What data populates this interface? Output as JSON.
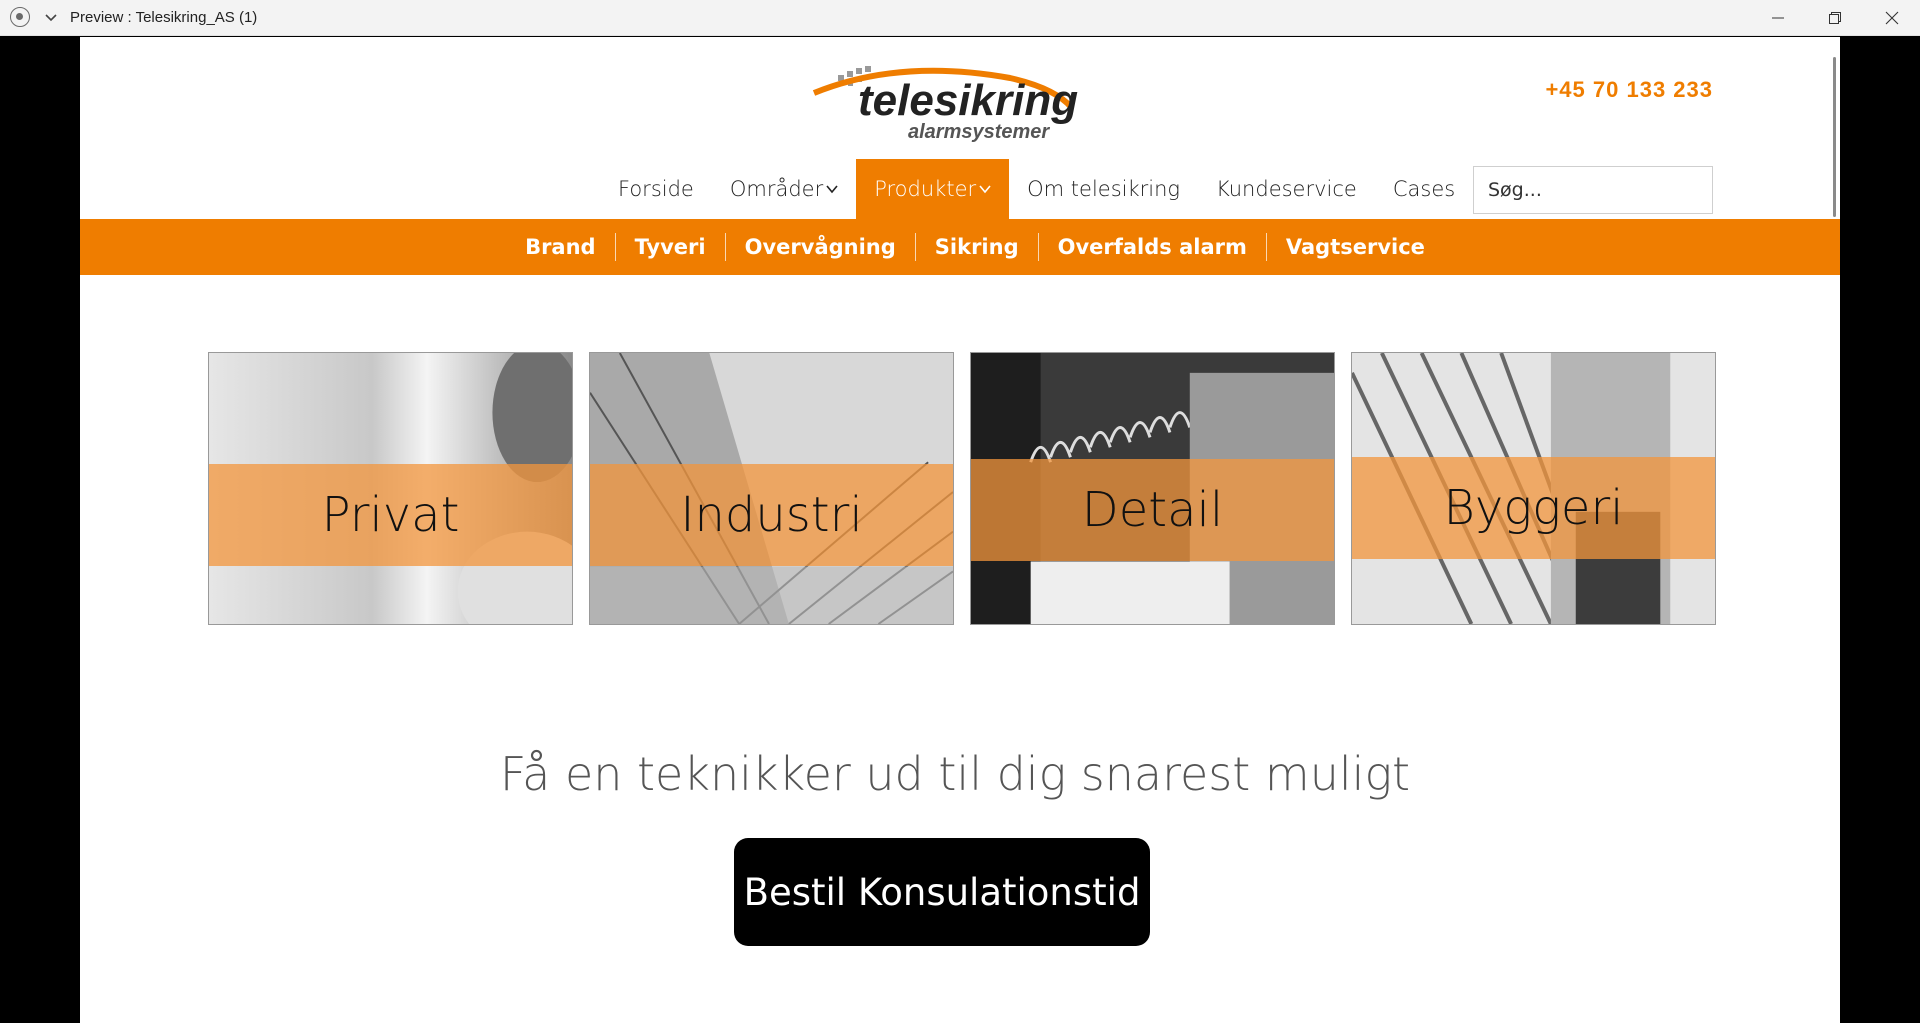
{
  "window": {
    "title": "Preview : Telesikring_AS (1)",
    "icons": [
      "record-icon",
      "chevron-down-icon",
      "minimize-icon",
      "restore-icon",
      "close-icon"
    ]
  },
  "header": {
    "logo_text": "telesikring",
    "logo_subtext": "alarmsystemer",
    "phone": "+45 70 133 233",
    "search_placeholder": "Søg..."
  },
  "nav": {
    "items": [
      {
        "label": "Forside"
      },
      {
        "label": "Områder"
      },
      {
        "label": "Produkter"
      },
      {
        "label": "Om telesikring"
      },
      {
        "label": "Kundeservice"
      },
      {
        "label": "Cases"
      }
    ],
    "active": "Produkter"
  },
  "subnav": {
    "items": [
      "Brand",
      "Tyveri",
      "Overvågning",
      "Sikring",
      "Overfalds alarm",
      "Vagtservice"
    ]
  },
  "tiles": [
    {
      "label": "Privat"
    },
    {
      "label": "Industri"
    },
    {
      "label": "Detail"
    },
    {
      "label": "Byggeri"
    }
  ],
  "cta": {
    "heading": "Få en teknikker ud til dig snarest muligt",
    "button": "Bestil Konsulationstid"
  },
  "colors": {
    "accent": "#ef7d00",
    "button_bg": "#000000"
  }
}
